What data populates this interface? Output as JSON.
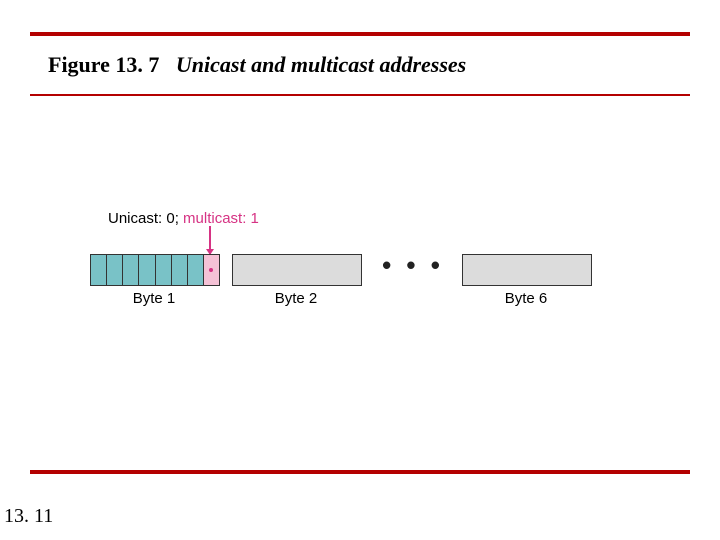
{
  "title": {
    "figure": "Figure 13. 7",
    "caption": "Unicast and multicast addresses"
  },
  "annotation": {
    "unicast": "Unicast: 0;",
    "multicast": "multicast: 1"
  },
  "bytes": {
    "b1": "Byte 1",
    "b2": "Byte 2",
    "b6": "Byte 6"
  },
  "ellipsis": "• • •",
  "page": "13. 11"
}
